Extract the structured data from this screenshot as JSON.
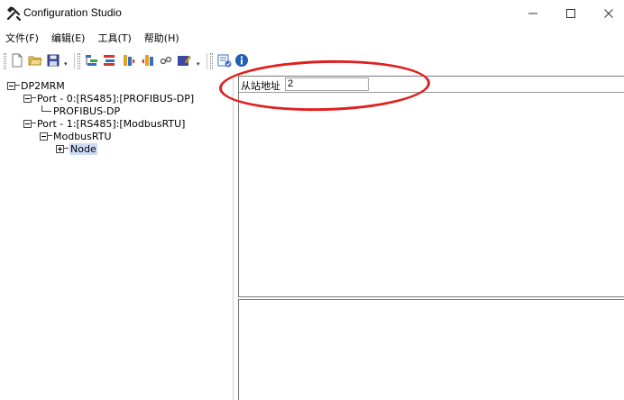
{
  "window": {
    "title": "Configuration Studio",
    "icon": "tools-icon",
    "controls": {
      "minimize": "─",
      "maximize": "☐",
      "close": "✕"
    }
  },
  "menu": {
    "items": [
      "文件(F)",
      "编辑(E)",
      "工具(T)",
      "帮助(H)"
    ]
  },
  "toolbar": {
    "buttons": [
      "new-file-icon",
      "open-folder-icon",
      "save-icon",
      "config-a-icon",
      "config-b-icon",
      "config-c-icon",
      "config-d-icon",
      "link-icon",
      "edit-icon",
      "download-icon",
      "info-icon"
    ]
  },
  "tree": {
    "root": "DP2MRM",
    "port0": "Port - 0:[RS485]:[PROFIBUS-DP]",
    "port0_child": "PROFIBUS-DP",
    "port1": "Port - 1:[RS485]:[ModbusRTU]",
    "port1_child": "ModbusRTU",
    "node": "Node"
  },
  "properties": {
    "slave_address_label": "从站地址",
    "slave_address_value": "2"
  },
  "colors": {
    "annotation": "#e02020",
    "selection": "#cfdcf7"
  }
}
